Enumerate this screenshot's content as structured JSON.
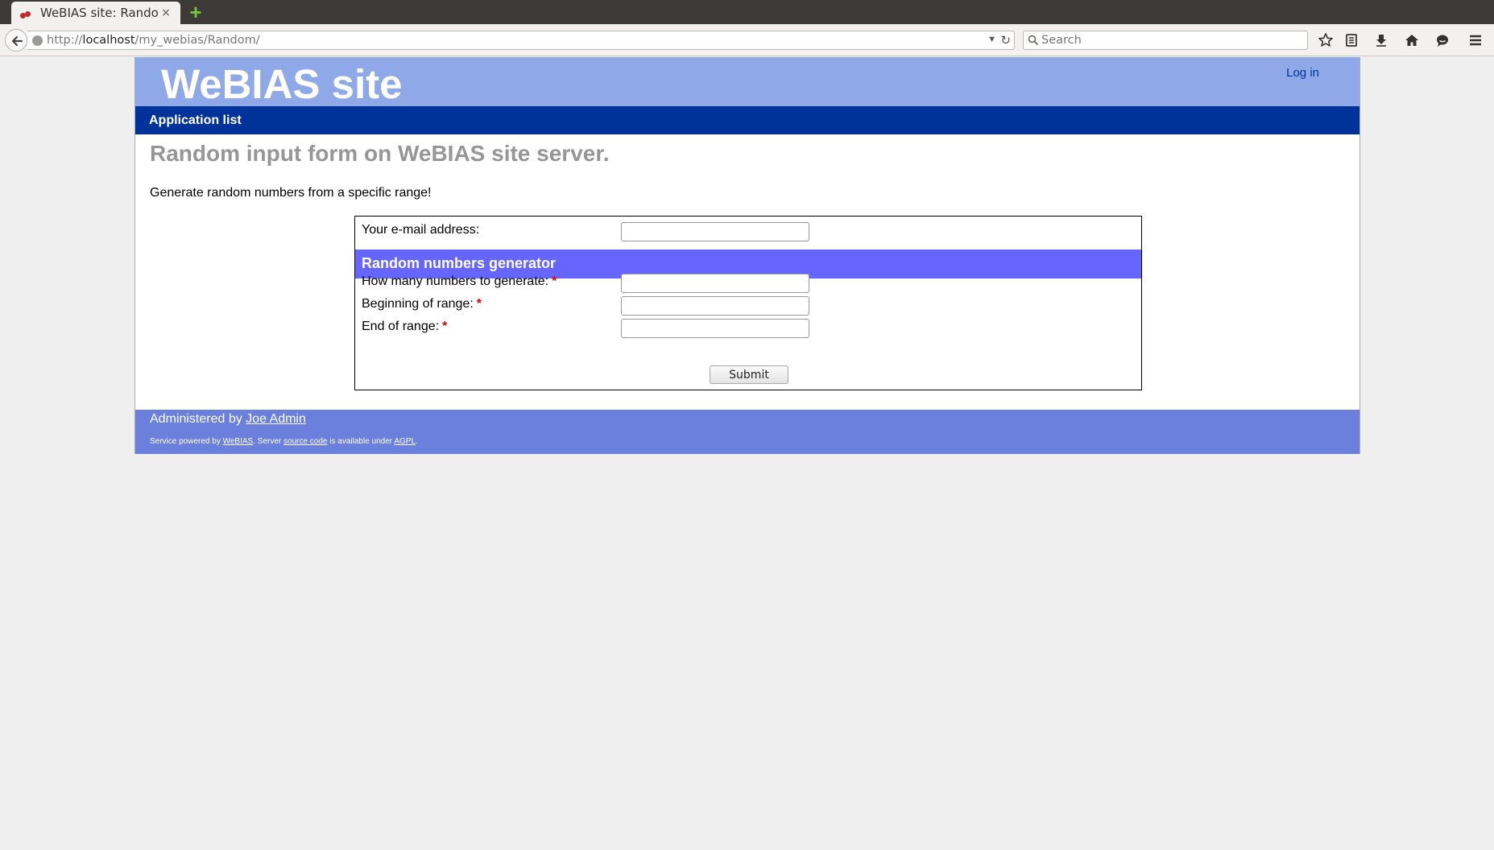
{
  "browser": {
    "tab_title": "WeBIAS site: Random",
    "tab_close": "×",
    "new_tab": "+",
    "url_prefix": "http://",
    "url_host": "localhost",
    "url_path": "/my_webias/Random/",
    "search_placeholder": "Search"
  },
  "header": {
    "site_title": "WeBIAS site",
    "login_label": "Log in"
  },
  "nav": {
    "application_list": "Application list"
  },
  "main": {
    "heading": "Random input form on WeBIAS site server.",
    "description": "Generate random numbers from a specific range!"
  },
  "form": {
    "email_label": "Your e-mail address:",
    "email_value": "",
    "section_title": "Random numbers generator",
    "required_mark": "*",
    "fields": [
      {
        "label": "How many numbers to generate:",
        "value": ""
      },
      {
        "label": "Beginning of range:",
        "value": ""
      },
      {
        "label": "End of range:",
        "value": ""
      }
    ],
    "submit_label": "Submit"
  },
  "footer": {
    "administered_by": "Administered by",
    "admin_name": "Joe Admin",
    "powered_1": "Service powered by",
    "powered_link_webias": "WeBIAS",
    "powered_2": ". Server",
    "powered_link_source": "source code",
    "powered_3": "is available under",
    "powered_link_agpl": "AGPL",
    "powered_4": "."
  },
  "colors": {
    "header_bg": "#8ea8e8",
    "nav_bg": "#003399",
    "section_bg": "#6666ff",
    "footer_bg": "#6b7fdd",
    "heading_color": "#969696"
  }
}
